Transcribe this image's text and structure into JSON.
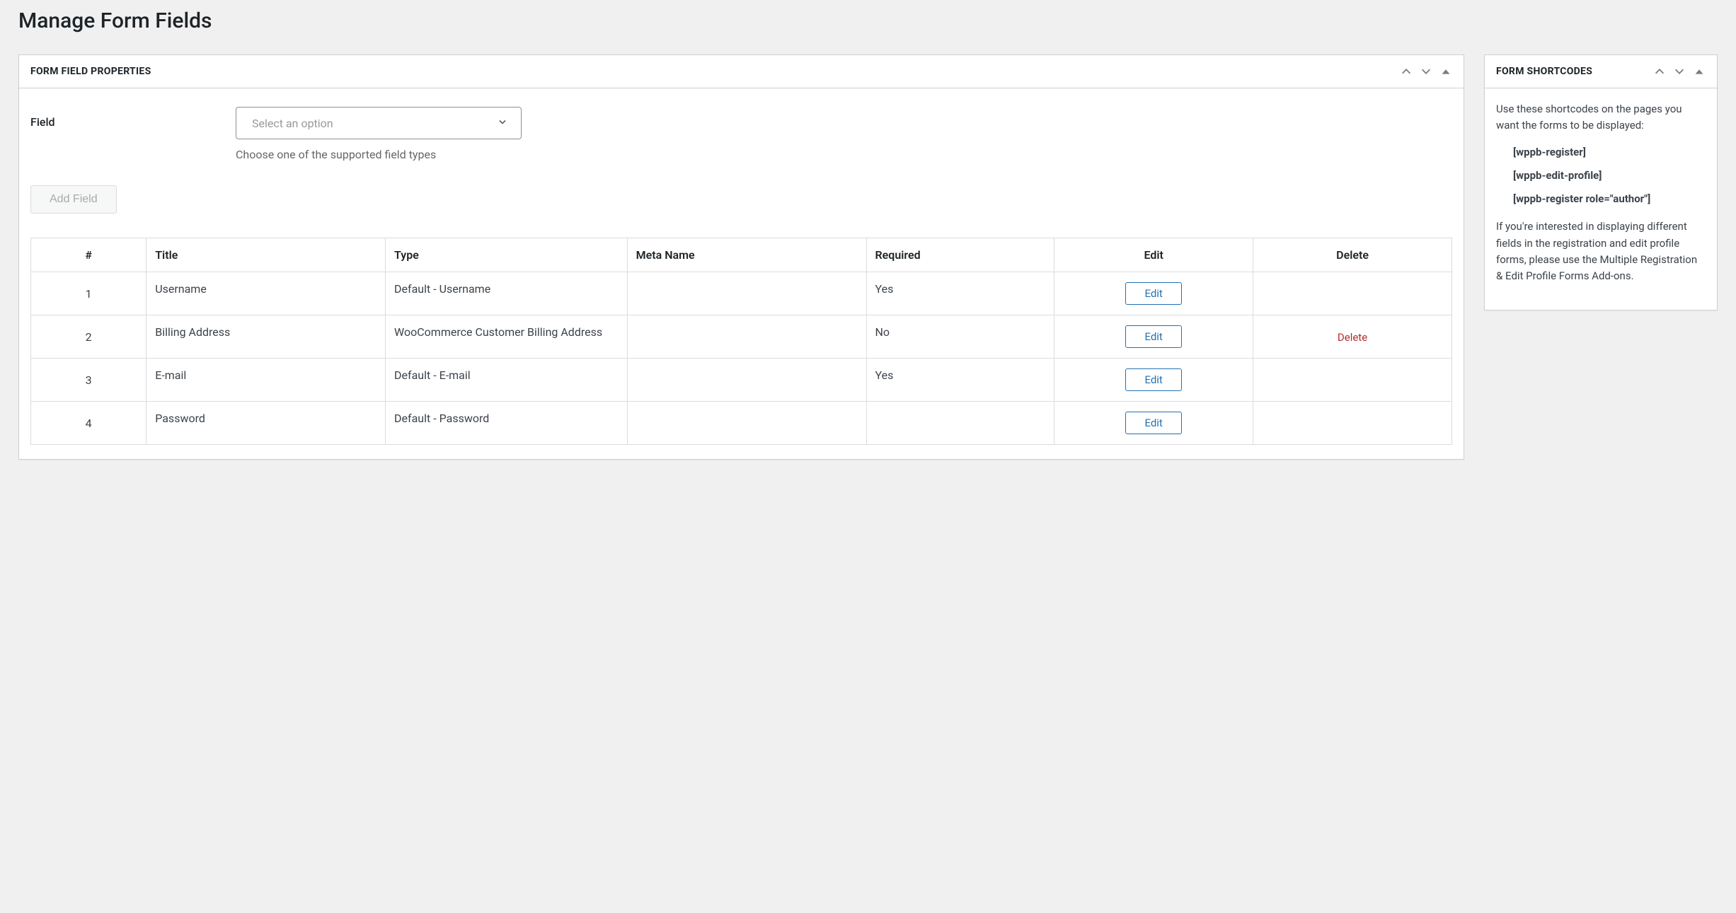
{
  "page": {
    "title": "Manage Form Fields"
  },
  "mainPanel": {
    "title": "FORM FIELD PROPERTIES",
    "fieldLabel": "Field",
    "selectPlaceholder": "Select an option",
    "helpText": "Choose one of the supported field types",
    "addButton": "Add Field"
  },
  "table": {
    "headers": {
      "num": "#",
      "title": "Title",
      "type": "Type",
      "meta": "Meta Name",
      "required": "Required",
      "edit": "Edit",
      "delete": "Delete"
    },
    "editLabel": "Edit",
    "deleteLabel": "Delete",
    "rows": [
      {
        "num": "1",
        "title": "Username",
        "type": "Default - Username",
        "meta": "",
        "required": "Yes",
        "deletable": false
      },
      {
        "num": "2",
        "title": "Billing Address",
        "type": "WooCommerce Customer Billing Address",
        "meta": "",
        "required": "No",
        "deletable": true
      },
      {
        "num": "3",
        "title": "E-mail",
        "type": "Default - E-mail",
        "meta": "",
        "required": "Yes",
        "deletable": false
      },
      {
        "num": "4",
        "title": "Password",
        "type": "Default - Password",
        "meta": "",
        "required": "",
        "deletable": false
      }
    ]
  },
  "sidebar": {
    "title": "FORM SHORTCODES",
    "intro": "Use these shortcodes on the pages you want the forms to be displayed:",
    "shortcodes": [
      "[wppb-register]",
      "[wppb-edit-profile]",
      "[wppb-register role=\"author\"]"
    ],
    "note": "If you're interested in displaying different fields in the registration and edit profile forms, please use the Multiple Registration & Edit Profile Forms Add-ons."
  }
}
